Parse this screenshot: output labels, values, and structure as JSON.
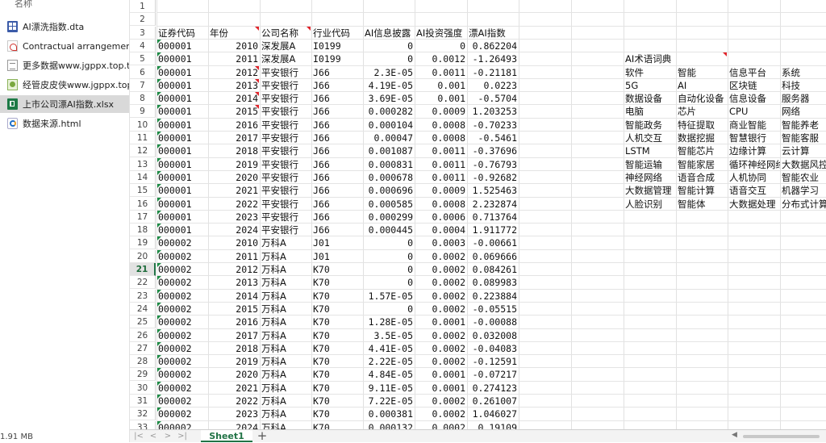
{
  "explorer": {
    "header": "名称",
    "files": [
      {
        "name": "AI漂洗指数.dta",
        "icon": "dta-file-icon",
        "selected": false
      },
      {
        "name": "Contractual arrangements",
        "icon": "pdf-file-icon",
        "selected": false
      },
      {
        "name": "更多数据www.jgppx.top.txt",
        "icon": "text-file-icon",
        "selected": false
      },
      {
        "name": "经管皮皮侠www.jgppx.top.",
        "icon": "url-shortcut-icon",
        "selected": false
      },
      {
        "name": "上市公司漂AI指数.xlsx",
        "icon": "excel-file-icon",
        "selected": true
      },
      {
        "name": "数据来源.html",
        "icon": "html-file-icon",
        "selected": false
      }
    ],
    "size_status": "1.91 MB"
  },
  "sheet": {
    "selected_row": 21,
    "row_numbers": [
      1,
      2,
      3,
      4,
      5,
      6,
      7,
      8,
      9,
      10,
      11,
      12,
      13,
      14,
      15,
      16,
      17,
      18,
      19,
      20,
      21,
      22,
      23,
      24,
      25,
      26,
      27,
      28,
      29,
      30,
      31,
      32,
      33
    ],
    "headers": [
      "证券代码",
      "年份",
      "公司名称",
      "行业代码",
      "AI信息披露",
      "AI投资强度",
      "漂AI指数"
    ],
    "rows": [
      [
        "000001",
        "2010",
        "深发展A",
        "I0199",
        "0",
        "0",
        "0.862204"
      ],
      [
        "000001",
        "2011",
        "深发展A",
        "I0199",
        "0",
        "0.0012",
        "-1.26493"
      ],
      [
        "000001",
        "2012",
        "平安银行",
        "J66",
        "2.3E-05",
        "0.0011",
        "-0.21181"
      ],
      [
        "000001",
        "2013",
        "平安银行",
        "J66",
        "4.19E-05",
        "0.001",
        "0.0223"
      ],
      [
        "000001",
        "2014",
        "平安银行",
        "J66",
        "3.69E-05",
        "0.001",
        "-0.5704"
      ],
      [
        "000001",
        "2015",
        "平安银行",
        "J66",
        "0.000282",
        "0.0009",
        "1.203253"
      ],
      [
        "000001",
        "2016",
        "平安银行",
        "J66",
        "0.000104",
        "0.0008",
        "-0.70233"
      ],
      [
        "000001",
        "2017",
        "平安银行",
        "J66",
        "0.00047",
        "0.0008",
        "-0.5461"
      ],
      [
        "000001",
        "2018",
        "平安银行",
        "J66",
        "0.001087",
        "0.0011",
        "-0.37696"
      ],
      [
        "000001",
        "2019",
        "平安银行",
        "J66",
        "0.000831",
        "0.0011",
        "-0.76793"
      ],
      [
        "000001",
        "2020",
        "平安银行",
        "J66",
        "0.000678",
        "0.0011",
        "-0.92682"
      ],
      [
        "000001",
        "2021",
        "平安银行",
        "J66",
        "0.000696",
        "0.0009",
        "1.525463"
      ],
      [
        "000001",
        "2022",
        "平安银行",
        "J66",
        "0.000585",
        "0.0008",
        "2.232874"
      ],
      [
        "000001",
        "2023",
        "平安银行",
        "J66",
        "0.000299",
        "0.0006",
        "0.713764"
      ],
      [
        "000001",
        "2024",
        "平安银行",
        "J66",
        "0.000445",
        "0.0004",
        "1.911772"
      ],
      [
        "000002",
        "2010",
        "万科A",
        "J01",
        "0",
        "0.0003",
        "-0.00661"
      ],
      [
        "000002",
        "2011",
        "万科A",
        "J01",
        "0",
        "0.0002",
        "0.069666"
      ],
      [
        "000002",
        "2012",
        "万科A",
        "K70",
        "0",
        "0.0002",
        "0.084261"
      ],
      [
        "000002",
        "2013",
        "万科A",
        "K70",
        "0",
        "0.0002",
        "0.089983"
      ],
      [
        "000002",
        "2014",
        "万科A",
        "K70",
        "1.57E-05",
        "0.0002",
        "0.223884"
      ],
      [
        "000002",
        "2015",
        "万科A",
        "K70",
        "0",
        "0.0002",
        "-0.05515"
      ],
      [
        "000002",
        "2016",
        "万科A",
        "K70",
        "1.28E-05",
        "0.0001",
        "-0.00088"
      ],
      [
        "000002",
        "2017",
        "万科A",
        "K70",
        "3.5E-05",
        "0.0002",
        "0.032008"
      ],
      [
        "000002",
        "2018",
        "万科A",
        "K70",
        "4.41E-05",
        "0.0002",
        "-0.04083"
      ],
      [
        "000002",
        "2019",
        "万科A",
        "K70",
        "2.22E-05",
        "0.0002",
        "-0.12591"
      ],
      [
        "000002",
        "2020",
        "万科A",
        "K70",
        "4.84E-05",
        "0.0001",
        "-0.07217"
      ],
      [
        "000002",
        "2021",
        "万科A",
        "K70",
        "9.11E-05",
        "0.0001",
        "0.274123"
      ],
      [
        "000002",
        "2022",
        "万科A",
        "K70",
        "7.22E-05",
        "0.0002",
        "0.261007"
      ],
      [
        "000002",
        "2023",
        "万科A",
        "K70",
        "0.000381",
        "0.0002",
        "1.046027"
      ],
      [
        "000002",
        "2024",
        "万科A",
        "K70",
        "0.000132",
        "0.0002",
        "0.19109"
      ]
    ],
    "glossary_title": "AI术语词典",
    "glossary": [
      [
        "软件",
        "智能",
        "信息平台",
        "系统"
      ],
      [
        "5G",
        "AI",
        "区块链",
        "科技"
      ],
      [
        "数据设备",
        "自动化设备",
        "信息设备",
        "服务器"
      ],
      [
        "电脑",
        "芯片",
        "CPU",
        "网络"
      ],
      [
        "智能政务",
        "特征提取",
        "商业智能",
        "智能养老"
      ],
      [
        "人机交互",
        "数据挖掘",
        "智慧银行",
        "智能客服"
      ],
      [
        "LSTM",
        "智能芯片",
        "边缘计算",
        "云计算"
      ],
      [
        "智能运输",
        "智能家居",
        "循环神经网络",
        "大数据风控"
      ],
      [
        "神经网络",
        "语音合成",
        "人机协同",
        "智能农业"
      ],
      [
        "大数据管理",
        "智能计算",
        "语音交互",
        "机器学习"
      ],
      [
        "人脸识别",
        "智能体",
        "大数据处理",
        "分布式计算"
      ]
    ]
  },
  "tabs": {
    "nav_first": "|<",
    "nav_prev": "<",
    "nav_next": ">",
    "nav_last": ">|",
    "sheets": [
      "Sheet1"
    ],
    "add_label": "+",
    "scroll_left": "◀"
  },
  "colors": {
    "accent_green": "#217346",
    "selected_file_bg": "#d9d9d9"
  }
}
